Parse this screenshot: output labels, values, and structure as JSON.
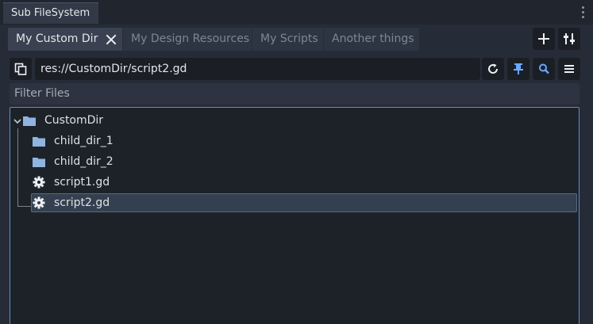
{
  "dock": {
    "tab_title": "Sub FileSystem",
    "menu_icon": "kebab-menu-icon"
  },
  "tabs": [
    {
      "label": "My Custom Dir",
      "active": true
    },
    {
      "label": "My Design Resources",
      "active": false
    },
    {
      "label": "My Scripts",
      "active": false
    },
    {
      "label": "Another things",
      "active": false
    }
  ],
  "toolbar": {
    "add_icon": "plus-icon",
    "settings_icon": "tools-icon",
    "copy_icon": "copy-path-icon",
    "refresh_icon": "refresh-icon",
    "pin_icon": "pin-icon",
    "search_icon": "search-icon",
    "menu_icon": "hamburger-menu-icon"
  },
  "path": {
    "value": "res://CustomDir/script2.gd"
  },
  "filter": {
    "placeholder": "Filter Files"
  },
  "tree": {
    "root": {
      "label": "CustomDir",
      "icon": "folder-icon",
      "expanded": true
    },
    "children": [
      {
        "label": "child_dir_1",
        "icon": "folder-icon",
        "selected": false
      },
      {
        "label": "child_dir_2",
        "icon": "folder-icon",
        "selected": false
      },
      {
        "label": "script1.gd",
        "icon": "gear-script-icon",
        "selected": false
      },
      {
        "label": "script2.gd",
        "icon": "gear-script-icon",
        "selected": true
      }
    ]
  },
  "colors": {
    "accent": "#5b8fd0",
    "folder": "#8fb4e0",
    "pin_active": "#6aa9ff",
    "search_active": "#6aa9ff"
  }
}
